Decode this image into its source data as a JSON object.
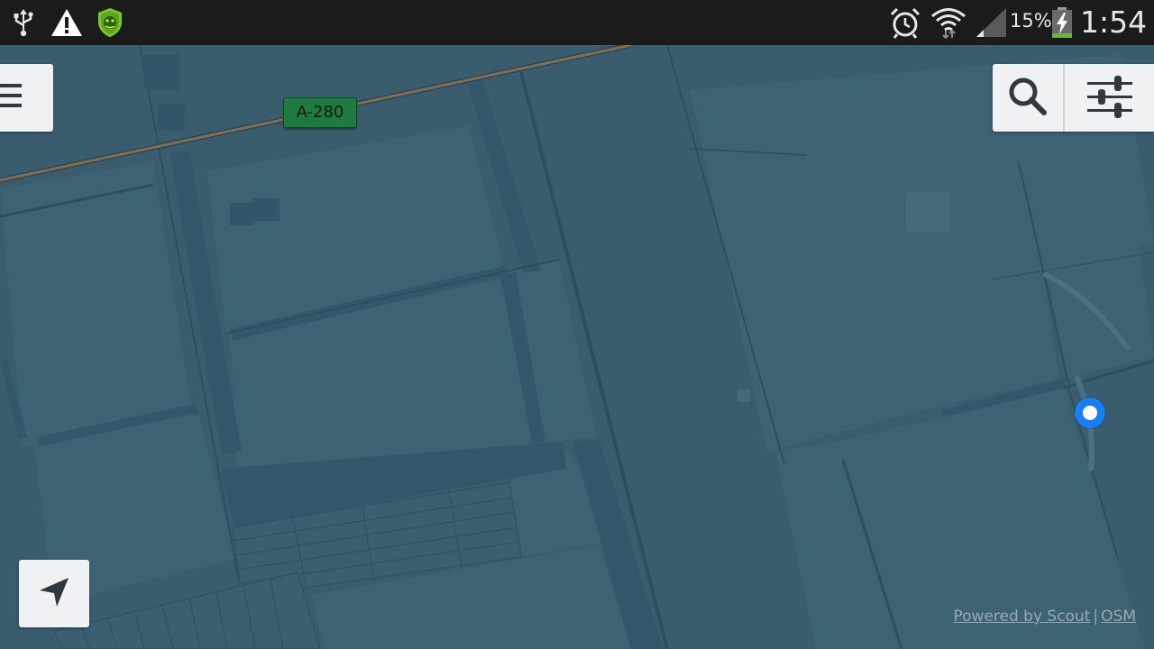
{
  "status_bar": {
    "battery_percent": "15%",
    "clock": "1:54",
    "icons": [
      "usb-icon",
      "warning-icon",
      "antivirus-shield-icon",
      "alarm-icon",
      "wifi-icon",
      "cell-signal-icon",
      "battery-charging-icon"
    ]
  },
  "map": {
    "road_shield": "A-280",
    "attribution": {
      "powered_by": "Powered by Scout",
      "separator": "|",
      "osm": "OSM"
    }
  },
  "controls": {
    "menu_icon": "hamburger-menu-icon",
    "search_icon": "search-icon",
    "filter_icon": "sliders-icon",
    "navigate_icon": "navigation-arrow-icon"
  },
  "colors": {
    "map_background": "#3a5d6e",
    "status_bar": "#1b1b1b",
    "button_background": "#eff1f2",
    "location_dot": "#1a7ef3",
    "road_shield": "#1e7a3e"
  }
}
